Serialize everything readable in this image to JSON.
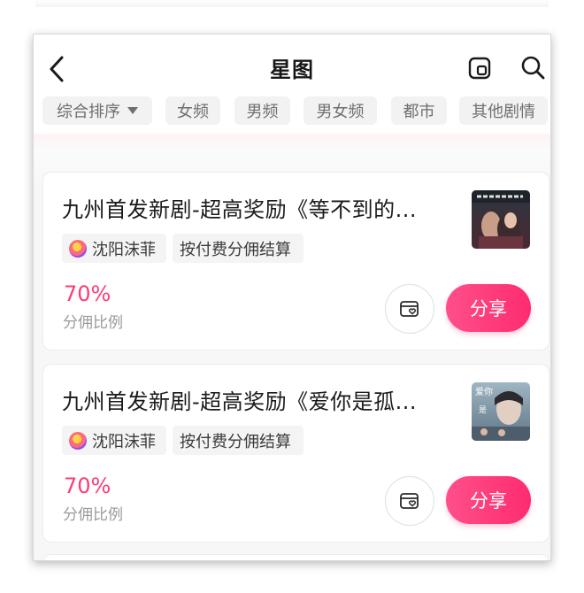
{
  "header": {
    "title": "星图"
  },
  "filters": [
    {
      "label": "综合排序",
      "has_dropdown": true
    },
    {
      "label": "女频"
    },
    {
      "label": "男频"
    },
    {
      "label": "男女频"
    },
    {
      "label": "都市"
    },
    {
      "label": "其他剧情"
    }
  ],
  "cards": [
    {
      "title": "九州首发新剧-超高奖励《等不到的...",
      "author": "沈阳沫菲",
      "settlement": "按付费分佣结算",
      "percent": "70%",
      "percent_label": "分佣比例",
      "share_label": "分享"
    },
    {
      "title": "九州首发新剧-超高奖励《爱你是孤...",
      "author": "沈阳沫菲",
      "settlement": "按付费分佣结算",
      "percent": "70%",
      "percent_label": "分佣比例",
      "share_label": "分享"
    }
  ],
  "colors": {
    "accent": "#fe3d72",
    "share_gradient_start": "#ff4f8a",
    "share_gradient_end": "#fd2c6f",
    "chip_bg": "#f2f2f2"
  },
  "icons": {
    "back": "chevron-left-icon",
    "header_action_1": "card-icon",
    "search": "search-icon",
    "favorite": "heart-card-icon"
  }
}
